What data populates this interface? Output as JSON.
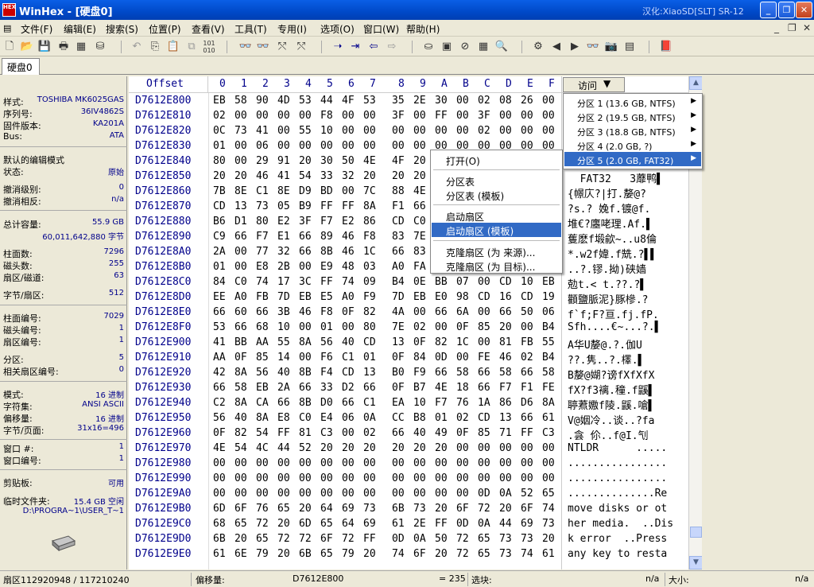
{
  "window": {
    "title": "WinHex - [硬盘0]",
    "right_text": "汉化:XiaoSD[SLT] SR-12",
    "icon_text": "HEX"
  },
  "menu": [
    "文件(F)",
    "编辑(E)",
    "搜索(S)",
    "位置(P)",
    "查看(V)",
    "工具(T)",
    "专用(I)",
    "选项(O)",
    "窗口(W)",
    "帮助(H)"
  ],
  "toolbar_icons": [
    "new-file-icon",
    "open-file-icon",
    "save-icon",
    "print-icon",
    "properties-icon",
    "open-disk-icon",
    "undo-icon",
    "copy-icon",
    "paste-icon",
    "paste-block-icon",
    "bitwise-icon",
    "find-text-icon",
    "find-hex-icon",
    "replace-text-icon",
    "replace-hex-icon",
    "goto-offset-icon",
    "goto-sector-icon",
    "back-icon",
    "forward-icon",
    "disk-editor-icon",
    "ram-editor-icon",
    "clone-disk-icon",
    "calculator-icon",
    "search-icon",
    "directory-icon",
    "prev-icon",
    "next-icon",
    "find-next-icon",
    "camera-icon",
    "table-icon",
    "help-book-icon"
  ],
  "tab": {
    "label": "硬盘0"
  },
  "info": {
    "model_k": "样式:",
    "model_v": "TOSHIBA MK6025GAS",
    "serial_k": "序列号:",
    "serial_v": "36IV4862S",
    "firmware_k": "固件版本:",
    "firmware_v": "KA201A",
    "bus_k": "Bus:",
    "bus_v": "ATA",
    "edit_mode_k": "默认的编辑模式",
    "state_k": "状态:",
    "state_v": "原始",
    "undo_level_k": "撤消级别:",
    "undo_level_v": "0",
    "undo_rev_k": "撤消相反:",
    "undo_rev_v": "n/a",
    "capacity_k": "总计容量:",
    "capacity_v": "55.9 GB",
    "capacity_bytes_v": "60,011,642,880 字节",
    "cylinders_k": "柱面数:",
    "cylinders_v": "7296",
    "heads_k": "磁头数:",
    "heads_v": "255",
    "spt_k": "扇区/磁道:",
    "spt_v": "63",
    "bps_k": "字节/扇区:",
    "bps_v": "512",
    "cyl_no_k": "柱面编号:",
    "cyl_no_v": "7029",
    "head_no_k": "磁头编号:",
    "head_no_v": "1",
    "sec_no_k": "扇区编号:",
    "sec_no_v": "1",
    "partition_k": "分区:",
    "partition_v": "5",
    "rel_sec_k": "相关扇区编号:",
    "rel_sec_v": "0",
    "mode_k": "模式:",
    "mode_v": "16 进制",
    "charset_k": "字符集:",
    "charset_v": "ANSI ASCII",
    "offsets_k": "偏移量:",
    "offsets_v": "16 进制",
    "bpp_k": "字节/页面:",
    "bpp_v": "31x16=496",
    "window_no_k": "窗口 #:",
    "window_no_v": "1",
    "window_num_k": "窗口编号:",
    "window_num_v": "1",
    "clipboard_k": "剪贴板:",
    "clipboard_v": "可用",
    "temp_k": "临时文件夹:",
    "temp_v": "15.4 GB 空闲",
    "temp_path_v": "D:\\PROGRA~1\\USER_T~1"
  },
  "hex": {
    "offset_label": "Offset",
    "columns": [
      "0",
      "1",
      "2",
      "3",
      "4",
      "5",
      "6",
      "7",
      "8",
      "9",
      "A",
      "B",
      "C",
      "D",
      "E",
      "F"
    ],
    "access_label": "访问",
    "rows": [
      {
        "off": "D7612E800",
        "bytes": [
          "EB",
          "58",
          "90",
          "4D",
          "53",
          "44",
          "4F",
          "53",
          "35",
          "2E",
          "30",
          "00",
          "02",
          "08",
          "26",
          "00"
        ],
        "text": ""
      },
      {
        "off": "D7612E810",
        "bytes": [
          "02",
          "00",
          "00",
          "00",
          "00",
          "F8",
          "00",
          "00",
          "3F",
          "00",
          "FF",
          "00",
          "3F",
          "00",
          "00",
          "00"
        ],
        "text": ""
      },
      {
        "off": "D7612E820",
        "bytes": [
          "0C",
          "73",
          "41",
          "00",
          "55",
          "10",
          "00",
          "00",
          "00",
          "00",
          "00",
          "00",
          "02",
          "00",
          "00",
          "00"
        ],
        "text": ""
      },
      {
        "off": "D7612E830",
        "bytes": [
          "01",
          "00",
          "06",
          "00",
          "00",
          "00",
          "00",
          "00",
          "00",
          "00",
          "00",
          "00",
          "00",
          "00",
          "00",
          "00"
        ],
        "text": ""
      },
      {
        "off": "D7612E840",
        "bytes": [
          "80",
          "00",
          "29",
          "91",
          "20",
          "30",
          "50",
          "4E",
          "4F",
          "20",
          "",
          "",
          "",
          "",
          "",
          ""
        ],
        "text": ""
      },
      {
        "off": "D7612E850",
        "bytes": [
          "20",
          "20",
          "46",
          "41",
          "54",
          "33",
          "32",
          "20",
          "20",
          "20",
          "",
          "",
          "",
          "",
          "",
          ""
        ],
        "text": "  FAT32   3蘼鸭▌"
      },
      {
        "off": "D7612E860",
        "bytes": [
          "7B",
          "8E",
          "C1",
          "8E",
          "D9",
          "BD",
          "00",
          "7C",
          "88",
          "4E",
          "",
          "",
          "",
          "",
          "",
          ""
        ],
        "text": "{幜庂?|打.嫠@?"
      },
      {
        "off": "D7612E870",
        "bytes": [
          "CD",
          "13",
          "73",
          "05",
          "B9",
          "FF",
          "FF",
          "8A",
          "F1",
          "66",
          "",
          "",
          "",
          "",
          "",
          ""
        ],
        "text": "?s.? 婏f.镀@f."
      },
      {
        "off": "D7612E880",
        "bytes": [
          "B6",
          "D1",
          "80",
          "E2",
          "3F",
          "F7",
          "E2",
          "86",
          "CD",
          "C0",
          "",
          "",
          "",
          "",
          "",
          ""
        ],
        "text": "堆€?廛咾理.Af.▌"
      },
      {
        "off": "D7612E890",
        "bytes": [
          "C9",
          "66",
          "F7",
          "E1",
          "66",
          "89",
          "46",
          "F8",
          "83",
          "7E",
          "",
          "",
          "",
          "",
          "",
          ""
        ],
        "text": "蒦麽f塅歈~..u8倫"
      },
      {
        "off": "D7612E8A0",
        "bytes": [
          "2A",
          "00",
          "77",
          "32",
          "66",
          "8B",
          "46",
          "1C",
          "66",
          "83",
          "",
          "",
          "",
          "",
          "",
          ""
        ],
        "text": "*.w2f媁.f兟.?▌▌"
      },
      {
        "off": "D7612E8B0",
        "bytes": [
          "01",
          "00",
          "E8",
          "2B",
          "00",
          "E9",
          "48",
          "03",
          "A0",
          "FA",
          "",
          "",
          "",
          "",
          "",
          ""
        ],
        "text": "..?.镠.拗)硖嫱"
      },
      {
        "off": "D7612E8C0",
        "bytes": [
          "84",
          "C0",
          "74",
          "17",
          "3C",
          "FF",
          "74",
          "09",
          "B4",
          "0E",
          "BB",
          "07",
          "00",
          "CD",
          "10",
          "EB"
        ],
        "text": "勊t.< t.??.?▌"
      },
      {
        "off": "D7612E8D0",
        "bytes": [
          "EE",
          "A0",
          "FB",
          "7D",
          "EB",
          "E5",
          "A0",
          "F9",
          "7D",
          "EB",
          "E0",
          "98",
          "CD",
          "16",
          "CD",
          "19"
        ],
        "text": "顴鹽脈泥}豚槮.?"
      },
      {
        "off": "D7612E8E0",
        "bytes": [
          "66",
          "60",
          "66",
          "3B",
          "46",
          "F8",
          "0F",
          "82",
          "4A",
          "00",
          "66",
          "6A",
          "00",
          "66",
          "50",
          "06"
        ],
        "text": "f`f;F?亘.fj.fP."
      },
      {
        "off": "D7612E8F0",
        "bytes": [
          "53",
          "66",
          "68",
          "10",
          "00",
          "01",
          "00",
          "80",
          "7E",
          "02",
          "00",
          "0F",
          "85",
          "20",
          "00",
          "B4"
        ],
        "text": "Sfh....€~...?.▌"
      },
      {
        "off": "D7612E900",
        "bytes": [
          "41",
          "BB",
          "AA",
          "55",
          "8A",
          "56",
          "40",
          "CD",
          "13",
          "0F",
          "82",
          "1C",
          "00",
          "81",
          "FB",
          "55"
        ],
        "text": "A华U嫠@.?.伽U"
      },
      {
        "off": "D7612E910",
        "bytes": [
          "AA",
          "0F",
          "85",
          "14",
          "00",
          "F6",
          "C1",
          "01",
          "0F",
          "84",
          "0D",
          "00",
          "FE",
          "46",
          "02",
          "B4"
        ],
        "text": "??.隽..?.檡.▌"
      },
      {
        "off": "D7612E920",
        "bytes": [
          "42",
          "8A",
          "56",
          "40",
          "8B",
          "F4",
          "CD",
          "13",
          "B0",
          "F9",
          "66",
          "58",
          "66",
          "58",
          "66",
          "58"
        ],
        "text": "B嫠@媩?谤fXfXfX"
      },
      {
        "off": "D7612E930",
        "bytes": [
          "66",
          "58",
          "EB",
          "2A",
          "66",
          "33",
          "D2",
          "66",
          "0F",
          "B7",
          "4E",
          "18",
          "66",
          "F7",
          "F1",
          "FE"
        ],
        "text": "fX?f3褵.穜.f鼷▌"
      },
      {
        "off": "D7612E940",
        "bytes": [
          "C2",
          "8A",
          "CA",
          "66",
          "8B",
          "D0",
          "66",
          "C1",
          "EA",
          "10",
          "F7",
          "76",
          "1A",
          "86",
          "D6",
          "8A"
        ],
        "text": "聤蔒嫐f陵.鼷.嗆▌"
      },
      {
        "off": "D7612E950",
        "bytes": [
          "56",
          "40",
          "8A",
          "E8",
          "C0",
          "E4",
          "06",
          "0A",
          "CC",
          "B8",
          "01",
          "02",
          "CD",
          "13",
          "66",
          "61"
        ],
        "text": "V@姻冷..谈..?fa"
      },
      {
        "off": "D7612E960",
        "bytes": [
          "0F",
          "82",
          "54",
          "FF",
          "81",
          "C3",
          "00",
          "02",
          "66",
          "40",
          "49",
          "0F",
          "85",
          "71",
          "FF",
          "C3"
        ],
        "text": ".侌 伱..f@I.刏"
      },
      {
        "off": "D7612E970",
        "bytes": [
          "4E",
          "54",
          "4C",
          "44",
          "52",
          "20",
          "20",
          "20",
          "20",
          "20",
          "20",
          "00",
          "00",
          "00",
          "00",
          "00"
        ],
        "text": "NTLDR      ....."
      },
      {
        "off": "D7612E980",
        "bytes": [
          "00",
          "00",
          "00",
          "00",
          "00",
          "00",
          "00",
          "00",
          "00",
          "00",
          "00",
          "00",
          "00",
          "00",
          "00",
          "00"
        ],
        "text": "................"
      },
      {
        "off": "D7612E990",
        "bytes": [
          "00",
          "00",
          "00",
          "00",
          "00",
          "00",
          "00",
          "00",
          "00",
          "00",
          "00",
          "00",
          "00",
          "00",
          "00",
          "00"
        ],
        "text": "................"
      },
      {
        "off": "D7612E9A0",
        "bytes": [
          "00",
          "00",
          "00",
          "00",
          "00",
          "00",
          "00",
          "00",
          "00",
          "00",
          "00",
          "00",
          "0D",
          "0A",
          "52",
          "65"
        ],
        "text": "..............Re"
      },
      {
        "off": "D7612E9B0",
        "bytes": [
          "6D",
          "6F",
          "76",
          "65",
          "20",
          "64",
          "69",
          "73",
          "6B",
          "73",
          "20",
          "6F",
          "72",
          "20",
          "6F",
          "74"
        ],
        "text": "move disks or ot"
      },
      {
        "off": "D7612E9C0",
        "bytes": [
          "68",
          "65",
          "72",
          "20",
          "6D",
          "65",
          "64",
          "69",
          "61",
          "2E",
          "FF",
          "0D",
          "0A",
          "44",
          "69",
          "73"
        ],
        "text": "her media.  ..Dis"
      },
      {
        "off": "D7612E9D0",
        "bytes": [
          "6B",
          "20",
          "65",
          "72",
          "72",
          "6F",
          "72",
          "FF",
          "0D",
          "0A",
          "50",
          "72",
          "65",
          "73",
          "73",
          "20"
        ],
        "text": "k error  ..Press "
      },
      {
        "off": "D7612E9E0",
        "bytes": [
          "61",
          "6E",
          "79",
          "20",
          "6B",
          "65",
          "79",
          "20",
          "74",
          "6F",
          "20",
          "72",
          "65",
          "73",
          "74",
          "61"
        ],
        "text": "any key to resta"
      }
    ]
  },
  "context_menu": {
    "items": [
      "打开(O)",
      "分区表",
      "分区表 (模板)",
      "启动扇区",
      "启动扇区 (模板)",
      "克隆扇区 (为 来源)...",
      "克隆扇区 (为 目标)..."
    ]
  },
  "submenu": {
    "items": [
      "分区 1 (13.6 GB, NTFS)",
      "分区 2 (19.5 GB, NTFS)",
      "分区 3 (18.8 GB, NTFS)",
      "分区 4 (2.0 GB, ?)",
      "分区 5 (2.0 GB, FAT32)"
    ]
  },
  "status": {
    "sector": "扇区112920948 / 117210240",
    "offset_k": "偏移量:",
    "offset_v": "D7612E800",
    "value": "= 235",
    "block_k": "选块:",
    "block_v": "n/a",
    "size_k": "大小:",
    "size_v": "n/a"
  },
  "colors": {
    "titlebar": "#0049c8",
    "selection": "#316ac5",
    "offset_text": "#00008b"
  }
}
